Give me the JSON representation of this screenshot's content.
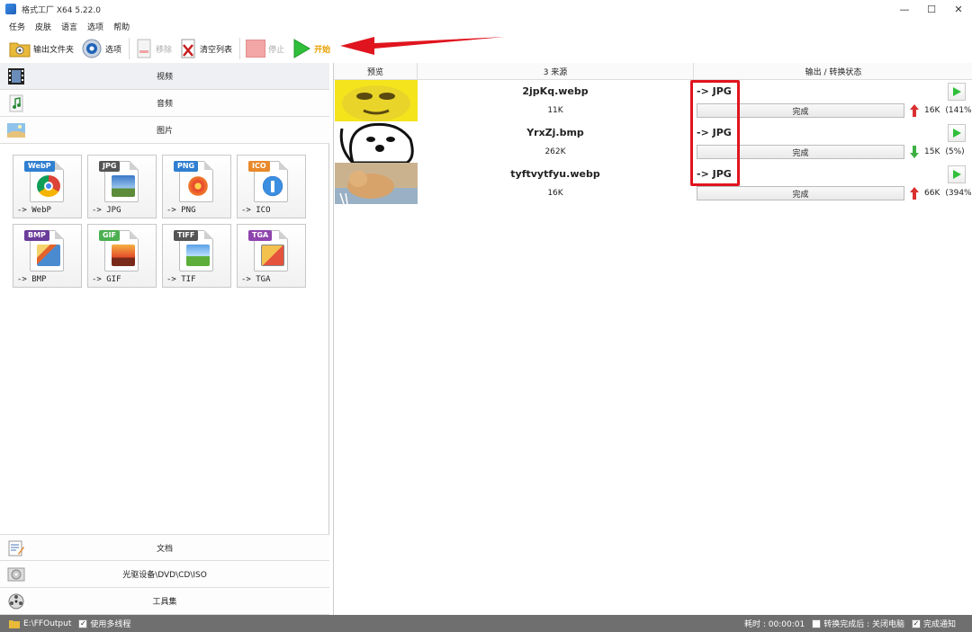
{
  "window": {
    "title": "格式工厂 X64 5.22.0",
    "minimize": "—",
    "maximize": "☐",
    "close": "✕"
  },
  "menu": [
    "任务",
    "皮肤",
    "语言",
    "选项",
    "帮助"
  ],
  "toolbar": {
    "output_folder": "输出文件夹",
    "options": "选项",
    "remove": "移除",
    "clear_list": "清空列表",
    "stop": "停止",
    "start": "开始"
  },
  "categories": {
    "video": "视频",
    "audio": "音频",
    "picture": "图片",
    "document": "文档",
    "optical": "光驱设备\\DVD\\CD\\ISO",
    "tools": "工具集"
  },
  "formats": [
    {
      "tag": "WebP",
      "label": "-> WebP",
      "color": "#2f7fd1"
    },
    {
      "tag": "JPG",
      "label": "-> JPG",
      "color": "#555555"
    },
    {
      "tag": "PNG",
      "label": "-> PNG",
      "color": "#2f7fd1"
    },
    {
      "tag": "ICO",
      "label": "-> ICO",
      "color": "#e8892b"
    },
    {
      "tag": "BMP",
      "label": "-> BMP",
      "color": "#6a3d9a"
    },
    {
      "tag": "GIF",
      "label": "-> GIF",
      "color": "#4caf50"
    },
    {
      "tag": "TIFF",
      "label": "-> TIF",
      "color": "#555555"
    },
    {
      "tag": "TGA",
      "label": "-> TGA",
      "color": "#8e44ad"
    }
  ],
  "table": {
    "headers": {
      "preview": "预览",
      "source": "3 来源",
      "output": "输出 / 转换状态"
    },
    "rows": [
      {
        "name": "2jpKq.webp",
        "size": "11K",
        "out": "-> JPG",
        "status": "完成",
        "result_size": "16K",
        "result_pct": "(141%)",
        "trend": "up"
      },
      {
        "name": "YrxZj.bmp",
        "size": "262K",
        "out": "-> JPG",
        "status": "完成",
        "result_size": "15K",
        "result_pct": "(5%)",
        "trend": "down"
      },
      {
        "name": "tyftvytfyu.webp",
        "size": "16K",
        "out": "-> JPG",
        "status": "完成",
        "result_size": "66K",
        "result_pct": "(394%)",
        "trend": "up"
      }
    ]
  },
  "footer": {
    "output_path": "E:\\FFOutput",
    "multithread": "使用多线程",
    "elapsed": "耗时 : 00:00:01",
    "after_convert": "转换完成后 : 关闭电脑",
    "notify": "完成通知"
  },
  "colors": {
    "accent_red": "#e0141e",
    "footer_bg": "#6f6f6f",
    "play_green": "#2fbf3a"
  }
}
